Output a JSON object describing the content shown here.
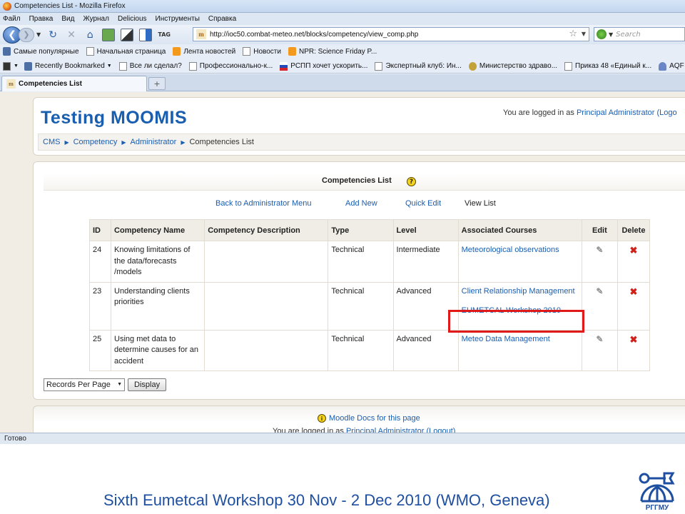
{
  "window": {
    "title": "Competencies List - Mozilla Firefox"
  },
  "menu": [
    "Файл",
    "Правка",
    "Вид",
    "Журнал",
    "Delicious",
    "Инструменты",
    "Справка"
  ],
  "navbar": {
    "url": "http://ioc50.combat-meteo.net/blocks/competency/view_comp.php",
    "search_placeholder": "Search",
    "tag_label": "TAG"
  },
  "bookmarks_row1": [
    "Самые популярные",
    "Начальная страница",
    "Лента новостей",
    "Новости",
    "NPR: Science Friday P..."
  ],
  "bookmarks_row2": [
    "Recently Bookmarked",
    "Все ли сделал?",
    "Профессионально-к...",
    "РСПП хочет ускорить...",
    "Экспертный клуб: Ин...",
    "Министерство здраво...",
    "Приказ 48 «Единый к...",
    "AQF > Project"
  ],
  "tab": {
    "title": "Competencies List"
  },
  "header": {
    "site_title": "Testing MOOMIS",
    "login_prefix": "You are logged in as",
    "login_user": "Principal Administrator",
    "login_suffix": " (Logo"
  },
  "breadcrumb": [
    "CMS",
    "Competency",
    "Administrator",
    "Competencies List"
  ],
  "list": {
    "title": "Competencies List",
    "actions": [
      "Back to Administrator Menu",
      "Add New",
      "Quick Edit",
      "View List"
    ],
    "columns": [
      "ID",
      "Competency Name",
      "Competency Description",
      "Type",
      "Level",
      "Associated Courses",
      "Edit",
      "Delete"
    ],
    "rows": [
      {
        "id": "24",
        "name": "Knowing limitations of the data/forecasts /models",
        "description": "",
        "type": "Technical",
        "level": "Intermediate",
        "courses": [
          "Meteorological observations"
        ]
      },
      {
        "id": "23",
        "name": "Understanding clients priorities",
        "description": "",
        "type": "Technical",
        "level": "Advanced",
        "courses": [
          "Client Relationship Management",
          "EUMETCAL Workshop 2010"
        ]
      },
      {
        "id": "25",
        "name": "Using met data to determine causes for an accident",
        "description": "",
        "type": "Technical",
        "level": "Advanced",
        "courses": [
          "Meteo Data Management"
        ]
      }
    ],
    "records_per_page": "Records Per Page",
    "display_button": "Display"
  },
  "footer": {
    "docs_link": "Moodle Docs for this page",
    "login_prefix": "You are logged in as",
    "login_user": "Principal Administrator",
    "logout": "(Logout)"
  },
  "status": "Готово",
  "caption": "Sixth Eumetcal Workshop 30 Nov - 2 Dec 2010 (WMO, Geneva)",
  "logo_text": "РГГМУ",
  "colors": {
    "link": "#1a5eb0",
    "highlight": "#e01a1a",
    "caption": "#1f4fa0"
  }
}
